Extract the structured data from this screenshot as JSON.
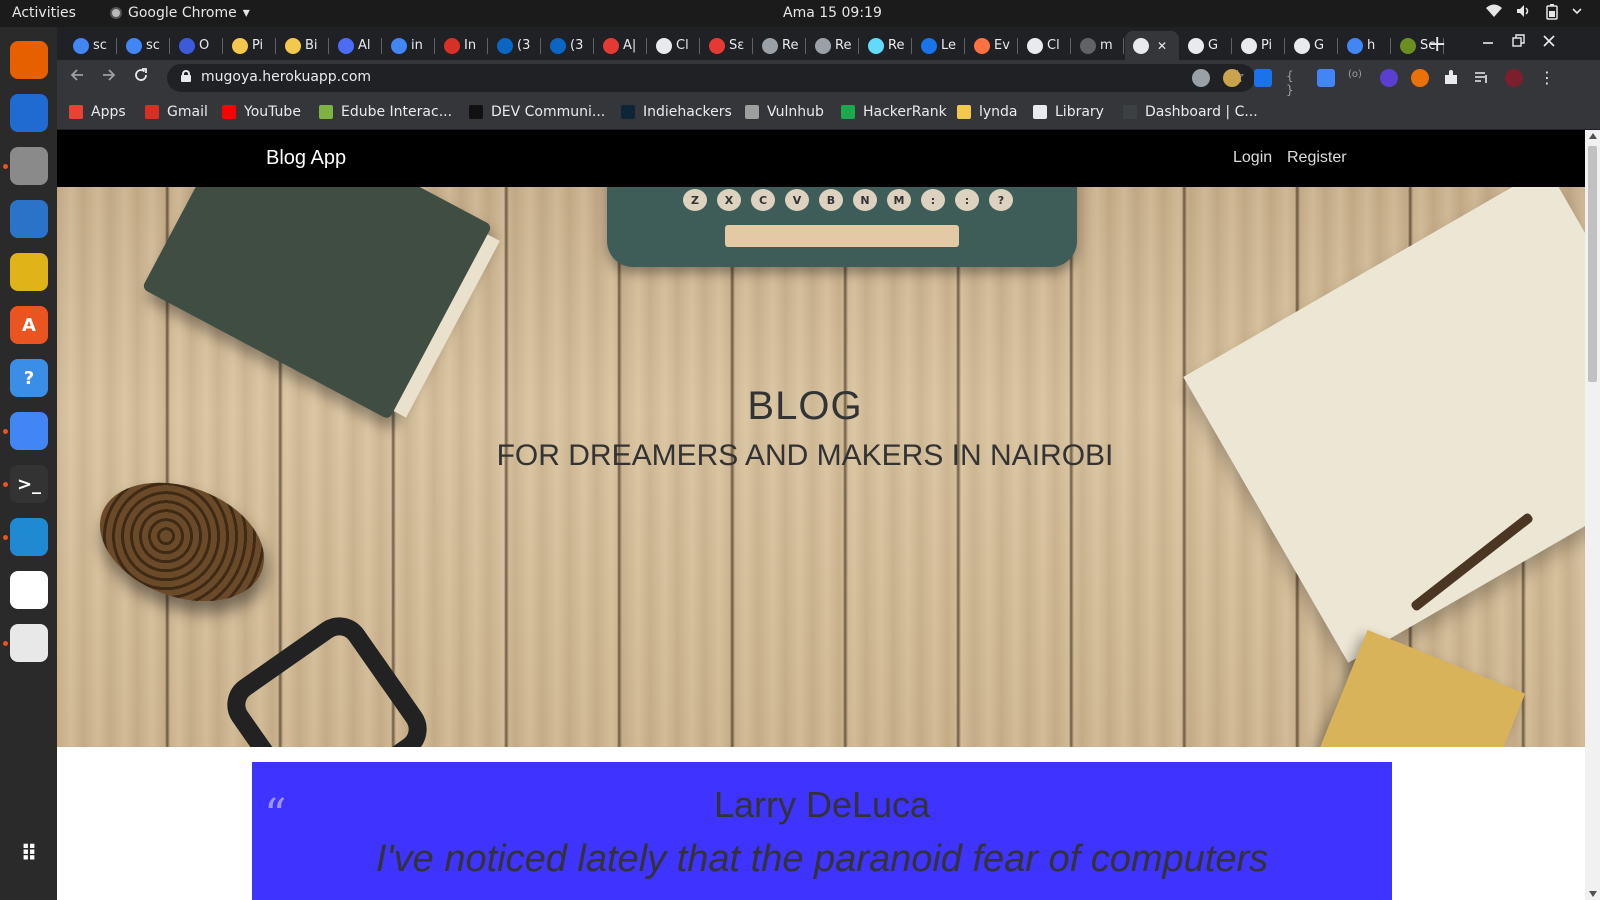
{
  "system": {
    "activities": "Activities",
    "app_name": "Google Chrome",
    "app_menu_arrow": "▾",
    "clock": "Ama 15  09:19"
  },
  "dock": {
    "items": [
      {
        "name": "firefox-icon",
        "glyph": "",
        "color": "#e66000"
      },
      {
        "name": "thunderbird-icon",
        "glyph": "",
        "color": "#1f6bd1"
      },
      {
        "name": "files-icon",
        "glyph": "",
        "color": "#8a8a8a"
      },
      {
        "name": "writer-icon",
        "glyph": "",
        "color": "#2a73c8"
      },
      {
        "name": "rhythmbox-icon",
        "glyph": "",
        "color": "#e0b418"
      },
      {
        "name": "software-icon",
        "glyph": "A",
        "color": "#e95420"
      },
      {
        "name": "help-icon",
        "glyph": "?",
        "color": "#3a8ee6"
      },
      {
        "name": "chrome-icon",
        "glyph": "",
        "color": "#4285f4"
      },
      {
        "name": "terminal-icon",
        "glyph": ">_",
        "color": "#333"
      },
      {
        "name": "vscode-icon",
        "glyph": "",
        "color": "#1f8ad2"
      },
      {
        "name": "slack-icon",
        "glyph": "",
        "color": "#ffffff"
      },
      {
        "name": "reader-icon",
        "glyph": "",
        "color": "#e8e8e8"
      }
    ],
    "apps_grid_glyph": "⠿"
  },
  "browser": {
    "tabs": [
      {
        "label": "sc",
        "fav": "#4285f4"
      },
      {
        "label": "sc",
        "fav": "#4285f4"
      },
      {
        "label": "O",
        "fav": "#3b5bdb"
      },
      {
        "label": "Pi",
        "fav": "#f2c94c"
      },
      {
        "label": "Bi",
        "fav": "#f2c94c"
      },
      {
        "label": "Al",
        "fav": "#4a6cf7"
      },
      {
        "label": "in",
        "fav": "#4285f4"
      },
      {
        "label": "In",
        "fav": "#d93025"
      },
      {
        "label": "(3",
        "fav": "#0a66c2"
      },
      {
        "label": "(3",
        "fav": "#0a66c2"
      },
      {
        "label": "A|",
        "fav": "#e53935"
      },
      {
        "label": "Cl",
        "fav": "#e8eaed"
      },
      {
        "label": "Sε",
        "fav": "#e53935"
      },
      {
        "label": "Re",
        "fav": "#9aa0a6"
      },
      {
        "label": "Re",
        "fav": "#9aa0a6"
      },
      {
        "label": "Re",
        "fav": "#61dafb"
      },
      {
        "label": "Le",
        "fav": "#1a73e8"
      },
      {
        "label": "Ev",
        "fav": "#ff7043"
      },
      {
        "label": "Cl",
        "fav": "#e8eaed"
      },
      {
        "label": "m",
        "fav": "#5f6368"
      },
      {
        "label": "",
        "fav": "#e8eaed",
        "active": true
      },
      {
        "label": "G",
        "fav": "#e8eaed"
      },
      {
        "label": "Pi",
        "fav": "#e8eaed"
      },
      {
        "label": "G",
        "fav": "#e8eaed"
      },
      {
        "label": "h",
        "fav": "#4285f4"
      },
      {
        "label": "Sc",
        "fav": "#6b8e23"
      }
    ],
    "tab_close": "✕",
    "new_tab": "+",
    "url": "mugoya.herokuapp.com",
    "bookmarks": [
      {
        "label": "Apps",
        "color": "#ea4335"
      },
      {
        "label": "Gmail",
        "color": "#d93025"
      },
      {
        "label": "YouTube",
        "color": "#ff0000"
      },
      {
        "label": "Edube Interac...",
        "color": "#7cb342"
      },
      {
        "label": "DEV Communi...",
        "color": "#111111"
      },
      {
        "label": "Indiehackers",
        "color": "#0e2439"
      },
      {
        "label": "Vulnhub",
        "color": "#9e9e9e"
      },
      {
        "label": "HackerRank",
        "color": "#1ba94c"
      },
      {
        "label": "lynda",
        "color": "#f2c94c"
      },
      {
        "label": "Library",
        "color": "#e8eaed"
      },
      {
        "label": "Dashboard | C...",
        "color": "#3c4043"
      }
    ]
  },
  "site": {
    "brand": "Blog App",
    "nav": {
      "login": "Login",
      "register": "Register"
    },
    "hero": {
      "title": "BLOG",
      "subtitle": "FOR DREAMERS AND MAKERS IN NAIROBI",
      "keys": [
        "Z",
        "X",
        "C",
        "V",
        "B",
        "N",
        "M",
        ":",
        ":",
        "?"
      ]
    },
    "quote": {
      "mark": "“",
      "author": "Larry DeLuca",
      "text": "I've noticed lately that the paranoid fear of computers"
    }
  }
}
